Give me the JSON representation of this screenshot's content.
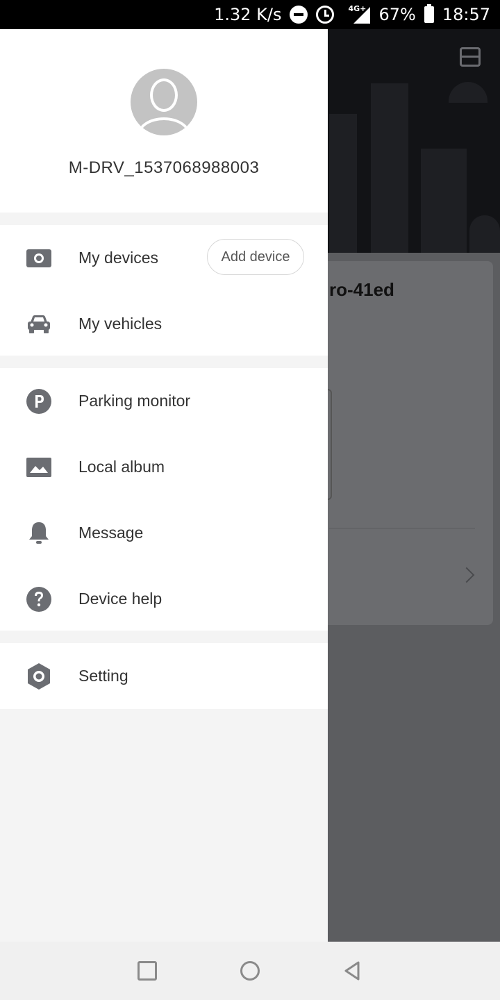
{
  "status_bar": {
    "speed": "1.32 K/s",
    "network": "4G+",
    "battery": "67%",
    "time": "18:57"
  },
  "background": {
    "card_title": "ro-41ed"
  },
  "drawer": {
    "username": "M-DRV_1537068988003",
    "items": [
      {
        "label": "My devices",
        "icon": "camera-icon"
      },
      {
        "label": "My vehicles",
        "icon": "car-icon"
      },
      {
        "label": "Parking monitor",
        "icon": "parking-icon"
      },
      {
        "label": "Local album",
        "icon": "image-icon"
      },
      {
        "label": "Message",
        "icon": "bell-icon"
      },
      {
        "label": "Device help",
        "icon": "help-icon"
      },
      {
        "label": "Setting",
        "icon": "settings-icon"
      }
    ],
    "add_device_label": "Add device"
  },
  "colors": {
    "icon": "#6b6d72",
    "text": "#333333",
    "drawer_bg": "#f4f4f4",
    "scrim": "#5c5d60"
  }
}
